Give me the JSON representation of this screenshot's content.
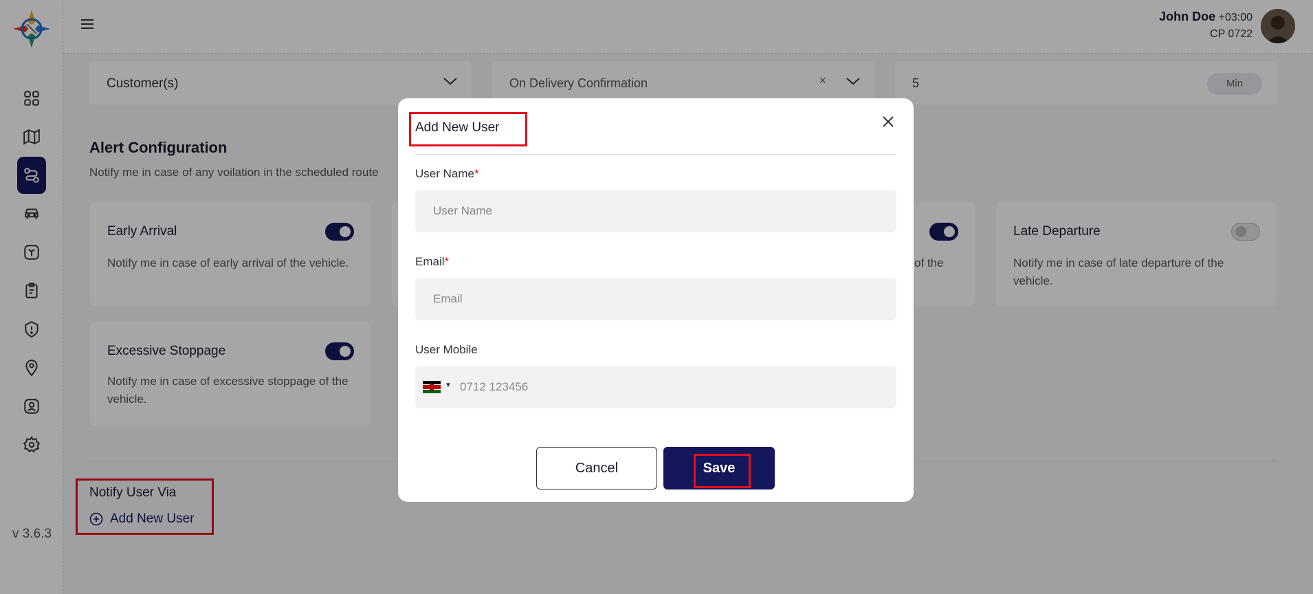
{
  "app": {
    "version": "v 3.6.3"
  },
  "header": {
    "user_name": "John Doe",
    "timezone": "+03:00",
    "user_code": "CP 0722"
  },
  "filters": {
    "customers_label": "Customer(s)",
    "trigger_label": "On Delivery Confirmation",
    "clear_symbol": "×",
    "minutes_value": "5",
    "minutes_unit": "Min"
  },
  "alerts": {
    "title": "Alert Configuration",
    "subtitle": "Notify me in case of any voilation in the scheduled route",
    "cards": [
      {
        "title": "Early Arrival",
        "desc": "Notify me in case of early arrival of the vehicle.",
        "enabled": true
      },
      {
        "title": "",
        "desc": "of the",
        "enabled": true
      },
      {
        "title": "Late Departure",
        "desc": "Notify me in case of late departure of the vehicle.",
        "enabled": false
      },
      {
        "title": "Excessive Stoppage",
        "desc": "Notify me in case of excessive stoppage of the vehicle.",
        "enabled": true
      }
    ]
  },
  "notify": {
    "title": "Notify User Via",
    "add_user_label": "Add New User"
  },
  "modal": {
    "title": "Add New User",
    "username_label": "User Name",
    "username_placeholder": "User Name",
    "email_label": "Email",
    "email_placeholder": "Email",
    "mobile_label": "User Mobile",
    "mobile_placeholder": "0712 123456",
    "required_mark": "*",
    "cancel_label": "Cancel",
    "save_label": "Save"
  },
  "colors": {
    "primary": "#15175c",
    "highlight": "#e3101c"
  }
}
